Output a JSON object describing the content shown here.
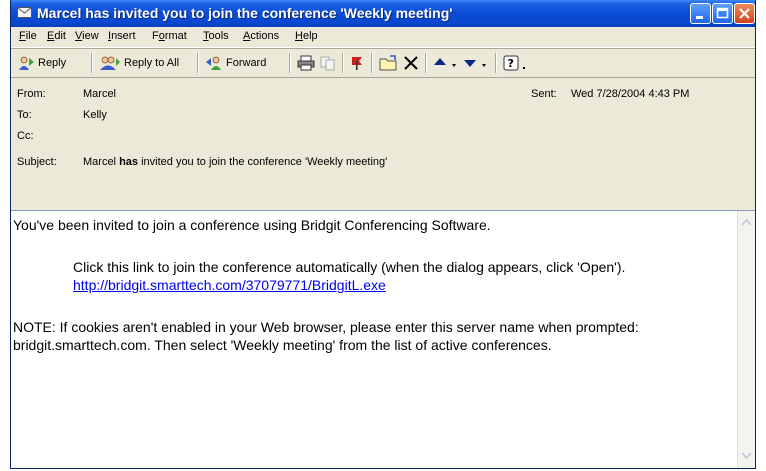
{
  "window": {
    "title": "Marcel has invited you to join the conference 'Weekly meeting'"
  },
  "menu": [
    {
      "label": "File",
      "key": "F",
      "rest": "ile"
    },
    {
      "label": "Edit",
      "key": "E",
      "rest": "dit"
    },
    {
      "label": "View",
      "key": "V",
      "rest": "iew"
    },
    {
      "label": "Insert",
      "key": "I",
      "rest": "nsert"
    },
    {
      "label": "Format",
      "pre": "F",
      "key": "o",
      "rest": "rmat"
    },
    {
      "label": "Tools",
      "key": "T",
      "rest": "ools"
    },
    {
      "label": "Actions",
      "key": "A",
      "rest": "ctions"
    },
    {
      "label": "Help",
      "key": "H",
      "rest": "elp"
    }
  ],
  "toolbar": {
    "reply": "Reply",
    "reply_all": "Reply to All",
    "forward": "Forward"
  },
  "header": {
    "from_label": "From:",
    "from": "Marcel",
    "to_label": "To:",
    "to": "Kelly",
    "cc_label": "Cc:",
    "cc": "",
    "subject_label": "Subject:",
    "subject_pre": "Marcel ",
    "subject_bold": "has",
    "subject_post": " invited you to join the conference 'Weekly meeting'",
    "sent_label": "Sent:",
    "sent": "Wed 7/28/2004 4:43 PM"
  },
  "body": {
    "line1": "You've been invited to join a conference using Bridgit Conferencing Software.",
    "line2": "Click this link to join the conference automatically (when the dialog appears, click 'Open').",
    "link": "http://bridgit.smarttech.com/37079771/BridgitL.exe",
    "note1": "NOTE: If cookies aren't enabled in your Web browser, please enter this server name when prompted:",
    "note2": "bridgit.smarttech.com. Then select 'Weekly meeting' from the list of active conferences."
  }
}
